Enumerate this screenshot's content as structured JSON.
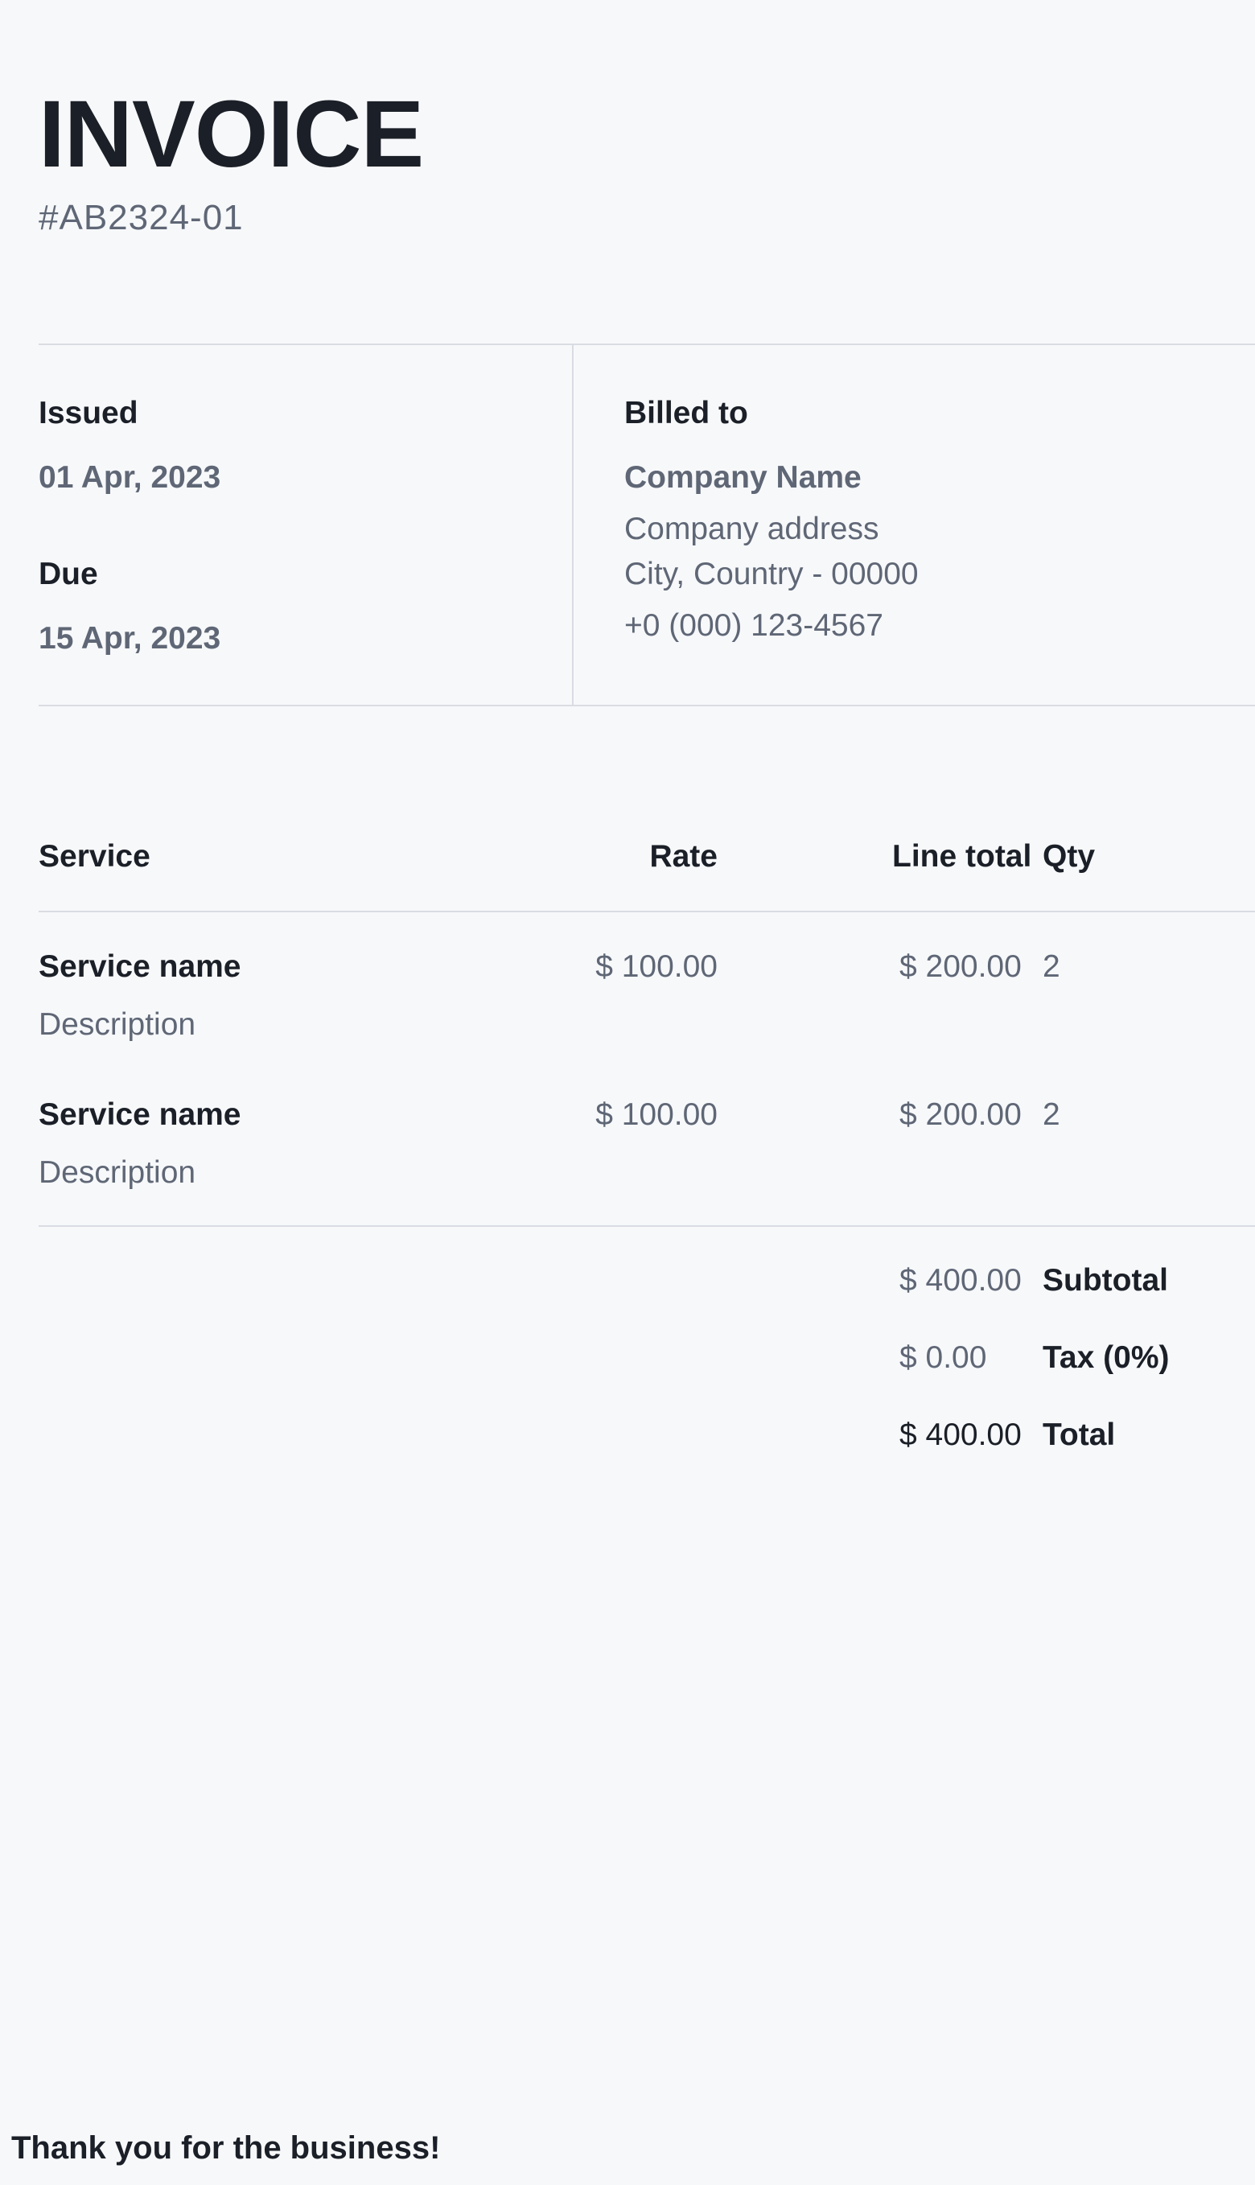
{
  "header": {
    "title": "INVOICE",
    "number": "#AB2324-01"
  },
  "dates": {
    "issued_label": "Issued",
    "issued_value": "01 Apr, 2023",
    "due_label": "Due",
    "due_value": "15 Apr, 2023"
  },
  "billing": {
    "label": "Billed to",
    "company_name": "Company Name",
    "address_line_1": "Company address",
    "address_line_2": "City, Country - 00000",
    "phone": "+0 (000) 123-4567"
  },
  "table": {
    "headers": {
      "service": "Service",
      "rate": "Rate",
      "line_total": "Line total",
      "qty": "Qty"
    },
    "rows": [
      {
        "name": "Service name",
        "description": "Description",
        "rate": "$ 100.00",
        "line_total": "$ 200.00",
        "qty": "2"
      },
      {
        "name": "Service name",
        "description": "Description",
        "rate": "$ 100.00",
        "line_total": "$ 200.00",
        "qty": "2"
      }
    ]
  },
  "totals": {
    "subtotal_value": "$ 400.00",
    "subtotal_label": "Subtotal",
    "tax_value": "$ 0.00",
    "tax_label": "Tax (0%)",
    "total_value": "$ 400.00",
    "total_label": "Total"
  },
  "footer": {
    "message": "Thank you for the business!"
  }
}
